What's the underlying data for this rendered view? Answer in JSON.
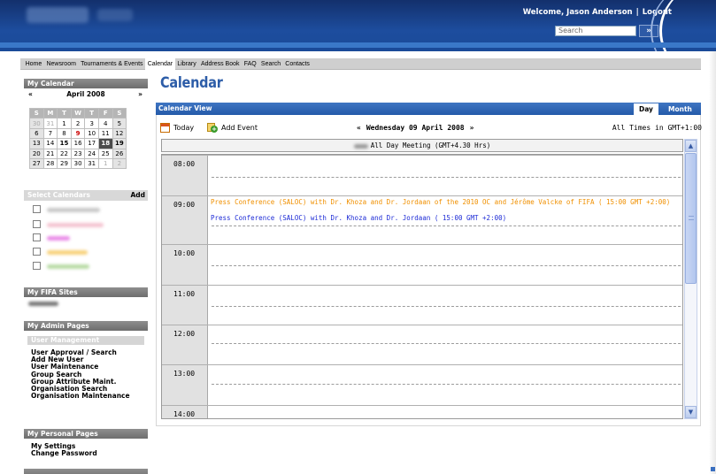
{
  "header": {
    "welcome": "Welcome, Jason Anderson",
    "separator": "|",
    "logout": "Logout",
    "search_placeholder": "Search",
    "search_go": "»"
  },
  "nav": [
    "Home",
    "Newsroom",
    "Tournaments & Events",
    "Calendar",
    "Library",
    "Address Book",
    "FAQ",
    "Search",
    "Contacts"
  ],
  "nav_active": "Calendar",
  "sidebar": {
    "my_calendar": "My Calendar",
    "prev": "«",
    "month": "April 2008",
    "next": "»",
    "dow": [
      "S",
      "M",
      "T",
      "W",
      "T",
      "F",
      "S"
    ],
    "weeks": [
      [
        "30",
        "31",
        "1",
        "2",
        "3",
        "4",
        "5"
      ],
      [
        "6",
        "7",
        "8",
        "9",
        "10",
        "11",
        "12"
      ],
      [
        "13",
        "14",
        "15",
        "16",
        "17",
        "18",
        "19"
      ],
      [
        "20",
        "21",
        "22",
        "23",
        "24",
        "25",
        "26"
      ],
      [
        "27",
        "28",
        "29",
        "30",
        "31",
        "1",
        "2"
      ]
    ],
    "select_calendars": "Select Calendars",
    "add": "Add",
    "my_fifa_sites": "My FIFA Sites",
    "my_admin_pages": "My Admin Pages",
    "user_management": "User Management",
    "admin_links": [
      "User Approval / Search",
      "Add New User",
      "User Maintenance",
      "Group Search",
      "Group Attribute Maint.",
      "Organisation Search",
      "Organisation Maintenance"
    ],
    "my_personal_pages": "My Personal Pages",
    "personal_links": [
      "My Settings",
      "Change Password"
    ]
  },
  "main": {
    "title": "Calendar",
    "calendar_view": "Calendar View",
    "tab_day": "Day",
    "tab_month": "Month",
    "today": "Today",
    "add_event": "Add Event",
    "prev": "«",
    "date": "Wednesday 09 April 2008",
    "next": "»",
    "timezone": "All Times in GMT+1:00",
    "all_day": "All Day Meeting (GMT+4.30 Hrs)",
    "hours": [
      "08:00",
      "09:00",
      "10:00",
      "11:00",
      "12:00",
      "13:00",
      "14:00"
    ],
    "events": [
      "Press Conference (SALOC) with Dr. Khoza and Dr. Jordaan of the 2010 OC and Jérôme Valcke of FIFA ( 15:00 GMT +2:00)",
      "Press Conference (SALOC) with Dr. Khoza and Dr. Jordaan ( 15:00 GMT +2:00)"
    ]
  },
  "colors": {
    "header_blue": "#1d4d9e",
    "title_blue": "#2d5da8",
    "event_orange": "#f09000",
    "event_blue": "#1d2bd6"
  }
}
